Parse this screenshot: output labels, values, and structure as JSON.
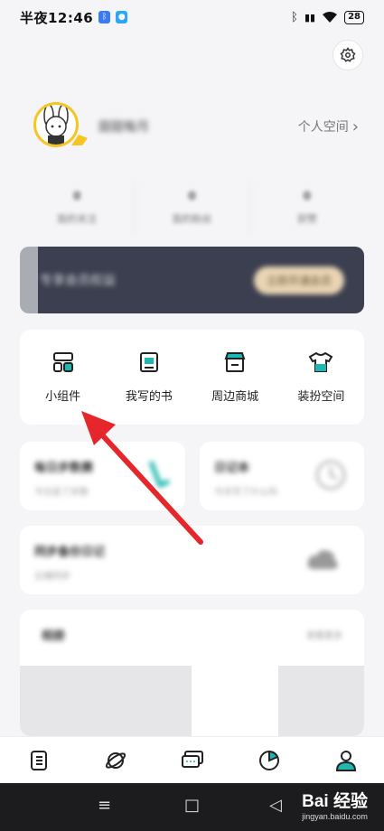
{
  "status_bar": {
    "time": "半夜12:46",
    "battery": "28"
  },
  "profile": {
    "nickname": "甜甜每月",
    "personal_space": "个人空间",
    "chevron": "›"
  },
  "stats": [
    {
      "value": "0",
      "label": "我的关注"
    },
    {
      "value": "0",
      "label": "我的粉丝"
    },
    {
      "value": "0",
      "label": "获赞"
    }
  ],
  "vip_banner": {
    "text": "专享会员权益",
    "button": "立即开通会员"
  },
  "shortcuts": [
    {
      "label": "小组件",
      "icon": "widget-icon"
    },
    {
      "label": "我写的书",
      "icon": "book-icon"
    },
    {
      "label": "周边商城",
      "icon": "shop-icon"
    },
    {
      "label": "装扮空间",
      "icon": "tshirt-icon"
    }
  ],
  "cards": {
    "left": {
      "title": "每日步数赛",
      "sub": "今日走了步数"
    },
    "right": {
      "title": "日记本",
      "sub": "今天写了什么吗"
    },
    "full": {
      "title": "同步备份日记",
      "sub": "云端同步"
    },
    "bottom": {
      "title": "相册",
      "more": "查看更多"
    }
  },
  "tabs": [
    {
      "name": "diary-tab",
      "icon": "notebook-icon"
    },
    {
      "name": "discover-tab",
      "icon": "planet-icon"
    },
    {
      "name": "messages-tab",
      "icon": "chat-icon"
    },
    {
      "name": "stats-tab",
      "icon": "pie-chart-icon"
    },
    {
      "name": "profile-tab",
      "icon": "person-icon"
    }
  ],
  "watermark": {
    "line1": "Bai 经验",
    "line2": "jingyan.baidu.com"
  },
  "colors": {
    "accent": "#1fb8b0",
    "arrow": "#e5262b",
    "banner": "#3b3f4f"
  }
}
